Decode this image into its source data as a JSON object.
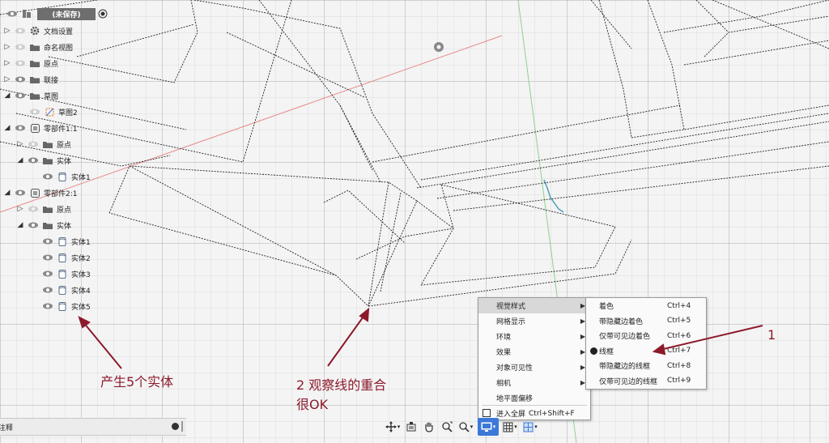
{
  "browser": {
    "root_label": "(未保存)",
    "items": [
      {
        "label": "文档设置",
        "icon": "gear-icon",
        "expander": "collapsed"
      },
      {
        "label": "命名视图",
        "icon": "folder-icon",
        "expander": "collapsed"
      },
      {
        "label": "原点",
        "icon": "folder-icon",
        "expander": "collapsed"
      },
      {
        "label": "联接",
        "icon": "folder-icon",
        "expander": "collapsed"
      },
      {
        "label": "草图",
        "icon": "folder-icon",
        "expander": "expanded"
      },
      {
        "label": "草图2",
        "icon": "sketch-icon",
        "expander": "none"
      },
      {
        "label": "零部件1:1",
        "icon": "component-icon",
        "expander": "expanded"
      },
      {
        "label": "原点",
        "icon": "folder-icon",
        "expander": "collapsed"
      },
      {
        "label": "实体",
        "icon": "folder-icon",
        "expander": "expanded"
      },
      {
        "label": "实体1",
        "icon": "body-icon",
        "expander": "none"
      },
      {
        "label": "零部件2:1",
        "icon": "component-icon",
        "expander": "expanded"
      },
      {
        "label": "原点",
        "icon": "folder-icon",
        "expander": "collapsed"
      },
      {
        "label": "实体",
        "icon": "folder-icon",
        "expander": "expanded"
      },
      {
        "label": "实体1",
        "icon": "body-icon",
        "expander": "none"
      },
      {
        "label": "实体2",
        "icon": "body-icon",
        "expander": "none"
      },
      {
        "label": "实体3",
        "icon": "body-icon",
        "expander": "none"
      },
      {
        "label": "实体4",
        "icon": "body-icon",
        "expander": "none"
      },
      {
        "label": "实体5",
        "icon": "body-icon",
        "expander": "none"
      }
    ]
  },
  "comment_bar": {
    "label": "注释"
  },
  "display_menu": {
    "items": [
      {
        "label": "视觉样式",
        "has_submenu": true,
        "highlighted": true
      },
      {
        "label": "网格显示",
        "has_submenu": true
      },
      {
        "label": "环境",
        "has_submenu": true
      },
      {
        "label": "效果",
        "has_submenu": true
      },
      {
        "label": "对象可见性",
        "has_submenu": true
      },
      {
        "label": "相机",
        "has_submenu": true
      },
      {
        "label": "地平面偏移",
        "has_submenu": false
      },
      {
        "label": "进入全屏",
        "shortcut": "Ctrl+Shift+F",
        "has_submenu": false,
        "icon": "fullscreen-icon"
      }
    ]
  },
  "visual_style_submenu": {
    "items": [
      {
        "label": "着色",
        "shortcut": "Ctrl+4"
      },
      {
        "label": "带隐藏边着色",
        "shortcut": "Ctrl+5"
      },
      {
        "label": "仅带可见边着色",
        "shortcut": "Ctrl+6"
      },
      {
        "label": "线框",
        "shortcut": "Ctrl+7",
        "selected": true
      },
      {
        "label": "带隐藏边的线框",
        "shortcut": "Ctrl+8"
      },
      {
        "label": "仅带可见边的线框",
        "shortcut": "Ctrl+9"
      }
    ]
  },
  "toolbar": {
    "tools": [
      {
        "name": "orbit-icon",
        "dropdown": true
      },
      {
        "name": "look-at-icon",
        "dropdown": false
      },
      {
        "name": "pan-icon",
        "dropdown": false
      },
      {
        "name": "zoom-icon",
        "dropdown": false
      },
      {
        "name": "fit-icon",
        "dropdown": true
      },
      {
        "name": "display-settings-icon",
        "dropdown": true,
        "active": true
      },
      {
        "name": "grid-icon",
        "dropdown": true
      },
      {
        "name": "viewports-icon",
        "dropdown": true
      }
    ]
  },
  "annotations": {
    "bodies_note": "产生5个实体",
    "lines_note_line1": "2 观察线的重合",
    "lines_note_line2": "很OK",
    "menu_note": "1"
  },
  "colors": {
    "annotation": "#8b1a2b",
    "x_axis": "#e88a8a",
    "y_axis": "#8fd08f",
    "menu_highlight": "#d8d8d8",
    "toolbar_active": "#3c78d8"
  }
}
